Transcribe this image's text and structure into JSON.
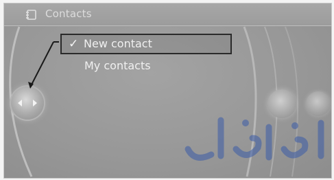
{
  "header": {
    "title": "Contacts",
    "icon": "contacts-icon"
  },
  "menu": {
    "items": [
      {
        "label": "New contact",
        "selected": true,
        "check": "✓"
      },
      {
        "label": "My contacts",
        "selected": false
      }
    ]
  },
  "colors": {
    "screen": "#9a9a9a",
    "text": "#f0f0f0",
    "highlight_border": "#2a2a2a",
    "watermark": "#3b5ca8"
  }
}
